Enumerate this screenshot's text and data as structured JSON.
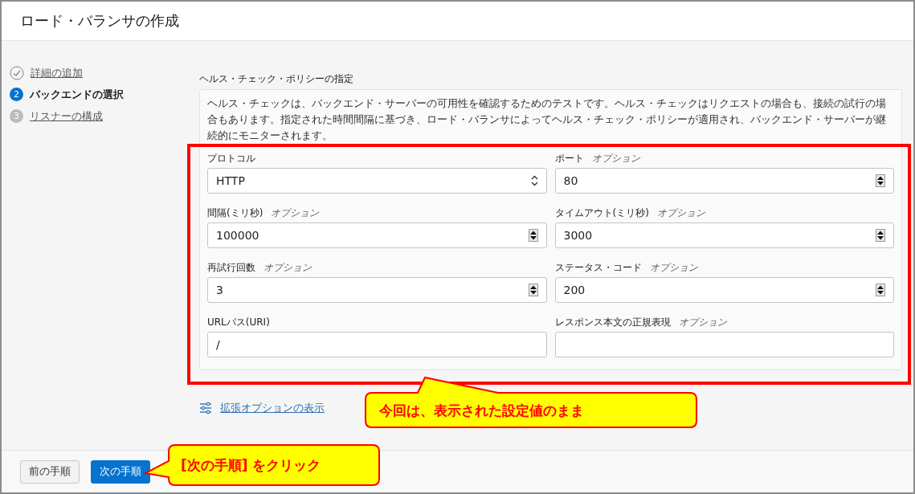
{
  "page": {
    "title": "ロード・バランサの作成"
  },
  "steps": [
    {
      "label": "詳細の追加",
      "completed": true,
      "selected": false
    },
    {
      "number": "2",
      "label": "バックエンドの選択",
      "completed": false,
      "selected": true
    },
    {
      "number": "3",
      "label": "リスナーの構成",
      "completed": false,
      "selected": false
    }
  ],
  "section": {
    "heading": "ヘルス・チェック・ポリシーの指定",
    "description": "ヘルス・チェックは、バックエンド・サーバーの可用性を確認するためのテストです。ヘルス・チェックはリクエストの場合も、接続の試行の場合もあります。指定された時間間隔に基づき、ロード・バランサによってヘルス・チェック・ポリシーが適用され、バックエンド・サーバーが継続的にモニターされます。",
    "fields": [
      {
        "label": "プロトコル",
        "kind": "select",
        "value": "HTTP"
      },
      {
        "label": "ポート",
        "optional": "オプション",
        "kind": "number",
        "value": "80"
      },
      {
        "label": "間隔(ミリ秒)",
        "optional": "オプション",
        "kind": "number",
        "value": "100000"
      },
      {
        "label": "タイムアウト(ミリ秒)",
        "optional": "オプション",
        "kind": "number",
        "value": "3000"
      },
      {
        "label": "再試行回数",
        "optional": "オプション",
        "kind": "number",
        "value": "3"
      },
      {
        "label": "ステータス・コード",
        "optional": "オプション",
        "kind": "number",
        "value": "200"
      },
      {
        "label": "URLパス(URI)",
        "kind": "text",
        "value": "/"
      },
      {
        "label": "レスポンス本文の正規表現",
        "optional": "オプション",
        "kind": "text"
      }
    ]
  },
  "advanced_link": "拡張オプションの表示",
  "footer": {
    "buttons": [
      {
        "label": "前の手順",
        "kind": "secondary"
      },
      {
        "label": "次の手順",
        "kind": "primary"
      }
    ]
  },
  "annotations": {
    "callouts": [
      {
        "text": "今回は、表示された設定値のまま",
        "kind": "up"
      },
      {
        "text": "[次の手順] をクリック",
        "kind": "left"
      }
    ]
  }
}
